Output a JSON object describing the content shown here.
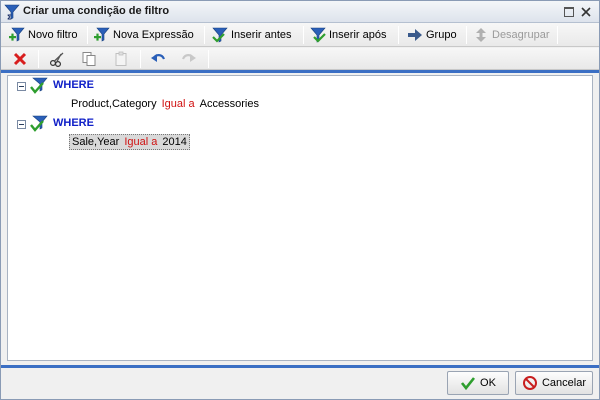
{
  "window": {
    "title": "Criar uma condição de filtro"
  },
  "toolbar": {
    "new_filter": "Novo filtro",
    "new_expression": "Nova Expressão",
    "insert_before": "Inserir antes",
    "insert_after": "Inserir após",
    "group": "Grupo",
    "ungroup": "Desagrupar"
  },
  "tree": {
    "nodes": [
      {
        "keyword": "WHERE",
        "condition": {
          "field": "Product,Category",
          "operator": "Igual a",
          "value": "Accessories"
        }
      },
      {
        "keyword": "WHERE",
        "condition": {
          "field": "Sale,Year",
          "operator": "Igual a",
          "value": "2014"
        }
      }
    ]
  },
  "footer": {
    "ok": "OK",
    "cancel": "Cancelar"
  },
  "colors": {
    "accent": "#3b6fc4",
    "keyword": "#1020c8",
    "operator": "#d01010",
    "delete": "#d81e1e"
  },
  "icons": {
    "app": "filter-sigma-icon",
    "new_filter": "filter-plus-icon",
    "new_expression": "filter-plus-icon",
    "insert_before": "filter-insert-before-icon",
    "insert_after": "filter-insert-after-icon",
    "group": "arrow-right-icon",
    "ungroup": "arrow-up-down-icon",
    "delete": "red-x-icon",
    "cut": "scissors-icon",
    "copy": "copy-icon",
    "paste": "paste-icon",
    "undo": "undo-icon",
    "redo": "redo-icon",
    "ok": "check-icon",
    "cancel": "no-sign-icon"
  }
}
